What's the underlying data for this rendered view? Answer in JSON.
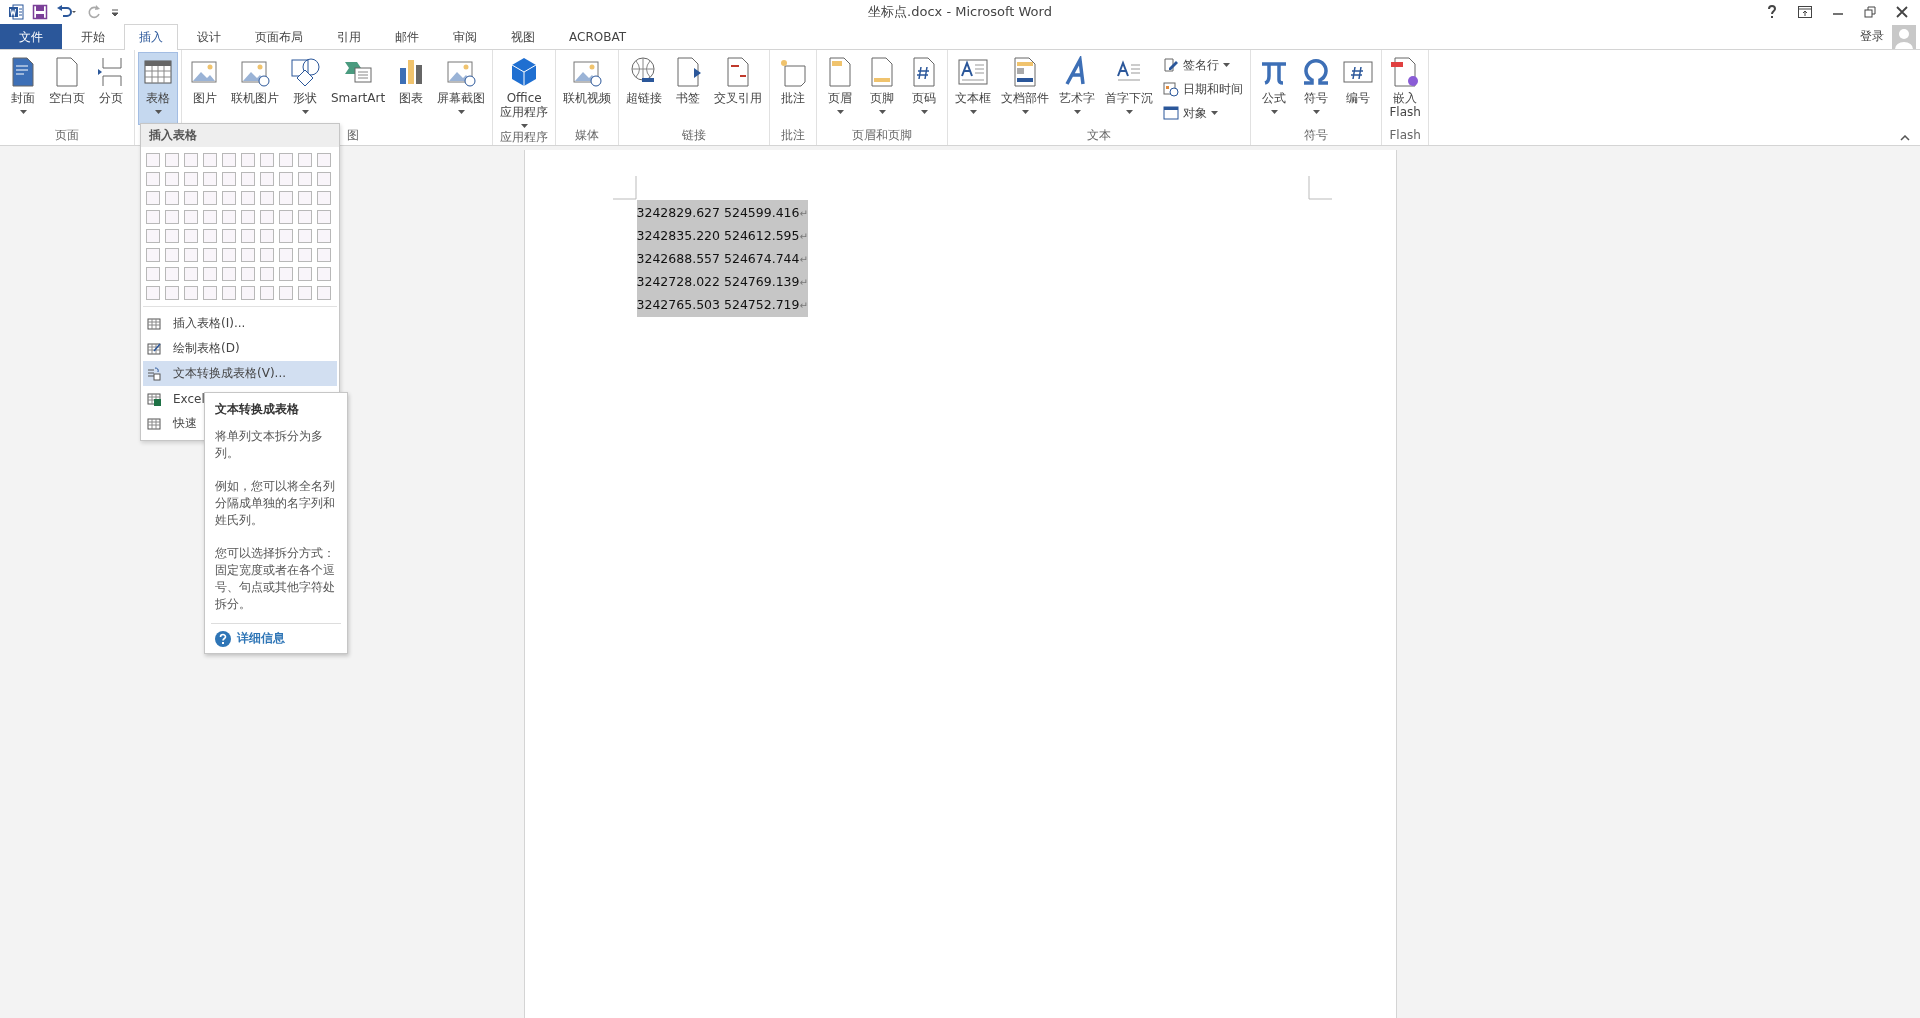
{
  "window": {
    "title": "坐标点.docx - Microsoft Word"
  },
  "account": {
    "login": "登录"
  },
  "tabs": [
    {
      "label": "文件",
      "kind": "file",
      "selected": false
    },
    {
      "label": "开始",
      "kind": "tab",
      "selected": false
    },
    {
      "label": "插入",
      "kind": "tab",
      "selected": true
    },
    {
      "label": "设计",
      "kind": "tab",
      "selected": false
    },
    {
      "label": "页面布局",
      "kind": "tab",
      "selected": false
    },
    {
      "label": "引用",
      "kind": "tab",
      "selected": false
    },
    {
      "label": "邮件",
      "kind": "tab",
      "selected": false
    },
    {
      "label": "审阅",
      "kind": "tab",
      "selected": false
    },
    {
      "label": "视图",
      "kind": "tab",
      "selected": false
    },
    {
      "label": "ACROBAT",
      "kind": "tab",
      "selected": false
    }
  ],
  "ribbon_groups": [
    {
      "label": "页面",
      "buttons": [
        {
          "kind": "large",
          "lines": [
            "封面"
          ],
          "caret": true,
          "selected": false
        },
        {
          "kind": "large",
          "lines": [
            "空白页"
          ],
          "caret": false,
          "selected": false
        },
        {
          "kind": "large",
          "lines": [
            "分页"
          ],
          "caret": false,
          "selected": false
        }
      ]
    },
    {
      "buttons": [
        {
          "kind": "large",
          "lines": [
            "表格"
          ],
          "caret": true,
          "selected": true
        }
      ]
    },
    {
      "label": "图",
      "buttons": [
        {
          "kind": "large",
          "lines": [
            "图片"
          ],
          "caret": false,
          "selected": false
        },
        {
          "kind": "large",
          "lines": [
            "联机图片"
          ],
          "caret": false,
          "selected": false
        },
        {
          "kind": "large",
          "lines": [
            "形状"
          ],
          "caret": true,
          "selected": false
        },
        {
          "kind": "large",
          "lines": [
            "SmartArt"
          ],
          "caret": false,
          "selected": false
        },
        {
          "kind": "large",
          "lines": [
            "图表"
          ],
          "caret": false,
          "selected": false
        },
        {
          "kind": "large",
          "lines": [
            "屏幕截图"
          ],
          "caret": true,
          "selected": false
        }
      ]
    },
    {
      "label": "应用程序",
      "buttons": [
        {
          "kind": "large",
          "lines": [
            "Office",
            "应用程序"
          ],
          "caret": true,
          "selected": false
        }
      ]
    },
    {
      "label": "媒体",
      "buttons": [
        {
          "kind": "large",
          "lines": [
            "联机视频"
          ],
          "caret": false,
          "selected": false
        }
      ]
    },
    {
      "label": "链接",
      "buttons": [
        {
          "kind": "large",
          "lines": [
            "超链接"
          ],
          "caret": false,
          "selected": false
        },
        {
          "kind": "large",
          "lines": [
            "书签"
          ],
          "caret": false,
          "selected": false
        },
        {
          "kind": "large",
          "lines": [
            "交叉引用"
          ],
          "caret": false,
          "selected": false
        }
      ]
    },
    {
      "label": "批注",
      "buttons": [
        {
          "kind": "large",
          "lines": [
            "批注"
          ],
          "caret": false,
          "selected": false
        }
      ]
    },
    {
      "label": "页眉和页脚",
      "buttons": [
        {
          "kind": "large",
          "lines": [
            "页眉"
          ],
          "caret": true,
          "selected": false
        },
        {
          "kind": "large",
          "lines": [
            "页脚"
          ],
          "caret": true,
          "selected": false
        },
        {
          "kind": "large",
          "lines": [
            "页码"
          ],
          "caret": true,
          "selected": false
        }
      ]
    },
    {
      "label": "文本",
      "buttons": [
        {
          "kind": "large",
          "lines": [
            "文本框"
          ],
          "caret": true,
          "selected": false
        },
        {
          "kind": "large",
          "lines": [
            "文档部件"
          ],
          "caret": true,
          "selected": false
        },
        {
          "kind": "large",
          "lines": [
            "艺术字"
          ],
          "caret": true,
          "selected": false
        },
        {
          "kind": "large",
          "lines": [
            "首字下沉"
          ],
          "caret": true,
          "selected": false
        },
        {
          "kind": "small",
          "lines": [
            "签名行"
          ],
          "caret": true,
          "selected": false
        },
        {
          "kind": "small",
          "lines": [
            "日期和时间"
          ],
          "caret": false,
          "selected": false
        },
        {
          "kind": "small",
          "lines": [
            "对象"
          ],
          "caret": true,
          "selected": false
        }
      ]
    },
    {
      "label": "符号",
      "buttons": [
        {
          "kind": "large",
          "lines": [
            "公式"
          ],
          "caret": true,
          "selected": false
        },
        {
          "kind": "large",
          "lines": [
            "符号"
          ],
          "caret": true,
          "selected": false
        },
        {
          "kind": "large",
          "lines": [
            "编号"
          ],
          "caret": false,
          "selected": false
        }
      ]
    },
    {
      "label": "Flash",
      "buttons": [
        {
          "kind": "large",
          "lines": [
            "嵌入",
            "Flash"
          ],
          "caret": false,
          "selected": false
        }
      ]
    }
  ],
  "table_menu": {
    "header": "插入表格",
    "items": [
      {
        "label": "插入表格(I)...",
        "selected": false
      },
      {
        "label": "绘制表格(D)",
        "selected": false
      },
      {
        "label": "文本转换成表格(V)...",
        "selected": true
      },
      {
        "label": "Excel",
        "selected": false
      },
      {
        "label": "快速",
        "selected": false
      }
    ]
  },
  "tooltip": {
    "title": "文本转换成表格",
    "paragraphs": [
      "将单列文本拆分为多列。",
      "例如，您可以将全名列分隔成单独的名字列和姓氏列。",
      "您可以选择拆分方式：固定宽度或者在各个逗号、句点或其他字符处拆分。"
    ],
    "link": "详细信息"
  },
  "document": {
    "selected": true,
    "lines": [
      {
        "text": "3242829.627 524599.416",
        "mark": "↵"
      },
      {
        "text": "3242835.220 524612.595",
        "mark": "↵"
      },
      {
        "text": "3242688.557 524674.744",
        "mark": "↵"
      },
      {
        "text": "3242728.022 524769.139",
        "mark": "↵"
      },
      {
        "text": "3242765.503 524752.719",
        "mark": "↵"
      }
    ]
  }
}
